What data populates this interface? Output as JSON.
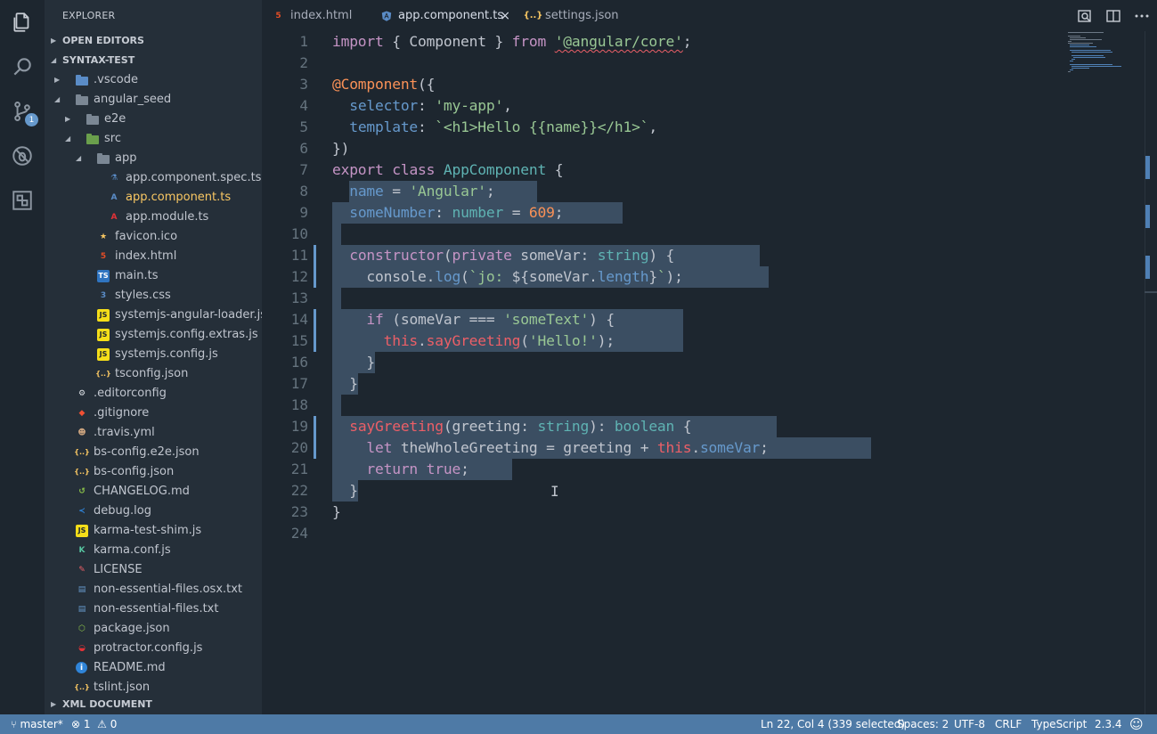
{
  "colors": {
    "accent": "#6699cc",
    "statusbar": "#4e7aa6",
    "sidebar": "#252f39",
    "editor": "#1d262f",
    "active_file": "#fac863"
  },
  "activity": {
    "icons": [
      "files-icon",
      "search-icon",
      "source-control-icon",
      "debug-icon",
      "extensions-icon"
    ],
    "scm_badge": "1"
  },
  "sidebar": {
    "title": "EXPLORER",
    "open_editors": "OPEN EDITORS",
    "project": "SYNTAX-TEST",
    "xml_document": "XML DOCUMENT",
    "tree": [
      {
        "label": ".vscode",
        "depth": 1,
        "twisty": "closed",
        "icon": "folder-blue"
      },
      {
        "label": "angular_seed",
        "depth": 1,
        "twisty": "open",
        "icon": "folder"
      },
      {
        "label": "e2e",
        "depth": 2,
        "twisty": "closed",
        "icon": "folder"
      },
      {
        "label": "src",
        "depth": 2,
        "twisty": "open",
        "icon": "folder-green"
      },
      {
        "label": "app",
        "depth": 3,
        "twisty": "open",
        "icon": "folder"
      },
      {
        "label": "app.component.spec.ts",
        "depth": 4,
        "icon": "flask"
      },
      {
        "label": "app.component.ts",
        "depth": 4,
        "icon": "angular-blue",
        "active": true
      },
      {
        "label": "app.module.ts",
        "depth": 4,
        "icon": "angular-red"
      },
      {
        "label": "favicon.ico",
        "depth": 3,
        "icon": "star"
      },
      {
        "label": "index.html",
        "depth": 3,
        "icon": "html5"
      },
      {
        "label": "main.ts",
        "depth": 3,
        "icon": "ts"
      },
      {
        "label": "styles.css",
        "depth": 3,
        "icon": "css3"
      },
      {
        "label": "systemjs-angular-loader.js",
        "depth": 3,
        "icon": "js"
      },
      {
        "label": "systemjs.config.extras.js",
        "depth": 3,
        "icon": "js"
      },
      {
        "label": "systemjs.config.js",
        "depth": 3,
        "icon": "js"
      },
      {
        "label": "tsconfig.json",
        "depth": 3,
        "icon": "json"
      },
      {
        "label": ".editorconfig",
        "depth": 1,
        "icon": "editorconfig"
      },
      {
        "label": ".gitignore",
        "depth": 1,
        "icon": "git"
      },
      {
        "label": ".travis.yml",
        "depth": 1,
        "icon": "travis"
      },
      {
        "label": "bs-config.e2e.json",
        "depth": 1,
        "icon": "json"
      },
      {
        "label": "bs-config.json",
        "depth": 1,
        "icon": "json"
      },
      {
        "label": "CHANGELOG.md",
        "depth": 1,
        "icon": "history"
      },
      {
        "label": "debug.log",
        "depth": 1,
        "icon": "vscode"
      },
      {
        "label": "karma-test-shim.js",
        "depth": 1,
        "icon": "js"
      },
      {
        "label": "karma.conf.js",
        "depth": 1,
        "icon": "karma"
      },
      {
        "label": "LICENSE",
        "depth": 1,
        "icon": "license"
      },
      {
        "label": "non-essential-files.osx.txt",
        "depth": 1,
        "icon": "text"
      },
      {
        "label": "non-essential-files.txt",
        "depth": 1,
        "icon": "text"
      },
      {
        "label": "package.json",
        "depth": 1,
        "icon": "npm"
      },
      {
        "label": "protractor.config.js",
        "depth": 1,
        "icon": "protractor"
      },
      {
        "label": "README.md",
        "depth": 1,
        "icon": "info"
      },
      {
        "label": "tslint.json",
        "depth": 1,
        "icon": "json"
      }
    ]
  },
  "tabs": [
    {
      "label": "index.html",
      "icon": "html5"
    },
    {
      "label": "app.component.ts",
      "icon": "angular-blue",
      "active": true,
      "close": "×"
    },
    {
      "label": "settings.json",
      "icon": "json"
    }
  ],
  "editor": {
    "lines": [
      [
        [
          "kw",
          "import"
        ],
        [
          "p",
          " { Component } "
        ],
        [
          "kw",
          "from"
        ],
        [
          "p",
          " "
        ],
        [
          "strsq",
          "'@angular/core'"
        ],
        [
          "p",
          ";"
        ]
      ],
      [],
      [
        [
          "dec",
          "@Component"
        ],
        [
          "p",
          "({"
        ]
      ],
      [
        [
          "p",
          "  "
        ],
        [
          "prop",
          "selector"
        ],
        [
          "p",
          ": "
        ],
        [
          "str",
          "'my-app'"
        ],
        [
          "p",
          ","
        ]
      ],
      [
        [
          "p",
          "  "
        ],
        [
          "prop",
          "template"
        ],
        [
          "p",
          ": "
        ],
        [
          "str",
          "`<h1>Hello {{name}}</h1>`"
        ],
        [
          "p",
          ","
        ]
      ],
      [
        [
          "p",
          "})"
        ]
      ],
      [
        [
          "kw",
          "export"
        ],
        [
          "p",
          " "
        ],
        [
          "kw",
          "class"
        ],
        [
          "p",
          " "
        ],
        [
          "typ",
          "AppComponent"
        ],
        [
          "p",
          " {"
        ]
      ],
      [
        [
          "p",
          "  "
        ],
        [
          "prop",
          "name"
        ],
        [
          "p",
          " = "
        ],
        [
          "str",
          "'Angular'"
        ],
        [
          "p",
          ";"
        ]
      ],
      [
        [
          "p",
          "  "
        ],
        [
          "prop",
          "someNumber"
        ],
        [
          "p",
          ": "
        ],
        [
          "typ",
          "number"
        ],
        [
          "p",
          " = "
        ],
        [
          "num",
          "609"
        ],
        [
          "p",
          ";"
        ]
      ],
      [],
      [
        [
          "p",
          "  "
        ],
        [
          "kw",
          "constructor"
        ],
        [
          "p",
          "("
        ],
        [
          "kw",
          "private"
        ],
        [
          "p",
          " someVar: "
        ],
        [
          "typ",
          "string"
        ],
        [
          "p",
          ") {"
        ]
      ],
      [
        [
          "p",
          "    console."
        ],
        [
          "prop",
          "log"
        ],
        [
          "p",
          "("
        ],
        [
          "str",
          "`jo: "
        ],
        [
          "p",
          "${someVar."
        ],
        [
          "prop",
          "length"
        ],
        [
          "p",
          "}"
        ],
        [
          "str",
          "`"
        ],
        [
          "p",
          ");"
        ]
      ],
      [],
      [
        [
          "p",
          "    "
        ],
        [
          "kw",
          "if"
        ],
        [
          "p",
          " (someVar === "
        ],
        [
          "str",
          "'someText'"
        ],
        [
          "p",
          ") {"
        ]
      ],
      [
        [
          "p",
          "      "
        ],
        [
          "this",
          "this"
        ],
        [
          "p",
          "."
        ],
        [
          "fn",
          "sayGreeting"
        ],
        [
          "p",
          "("
        ],
        [
          "str",
          "'Hello!'"
        ],
        [
          "p",
          ");"
        ]
      ],
      [
        [
          "p",
          "    }"
        ]
      ],
      [
        [
          "p",
          "  }"
        ]
      ],
      [],
      [
        [
          "p",
          "  "
        ],
        [
          "fn",
          "sayGreeting"
        ],
        [
          "p",
          "(greeting: "
        ],
        [
          "typ",
          "string"
        ],
        [
          "p",
          "): "
        ],
        [
          "typ",
          "boolean"
        ],
        [
          "p",
          " {"
        ]
      ],
      [
        [
          "p",
          "    "
        ],
        [
          "kw",
          "let"
        ],
        [
          "p",
          " theWholeGreeting = greeting + "
        ],
        [
          "this",
          "this"
        ],
        [
          "p",
          "."
        ],
        [
          "prop",
          "someVar"
        ],
        [
          "p",
          ";"
        ]
      ],
      [
        [
          "p",
          "    "
        ],
        [
          "kw",
          "return"
        ],
        [
          "p",
          " "
        ],
        [
          "kw",
          "true"
        ],
        [
          "p",
          ";"
        ]
      ],
      [
        [
          "p",
          "  }"
        ]
      ],
      [
        [
          "p",
          "}"
        ]
      ],
      []
    ],
    "selection_ends": [
      0,
      0,
      0,
      0,
      0,
      0,
      0,
      24,
      34,
      1,
      50,
      51,
      1,
      41,
      41,
      5,
      3,
      1,
      52,
      63,
      21,
      3,
      0,
      0
    ]
  },
  "status": {
    "branch": "master*",
    "errors": "1",
    "warnings": "0",
    "position": "Ln 22, Col 4 (339 selected)",
    "spaces": "Spaces: 2",
    "encoding": "UTF-8",
    "eol": "CRLF",
    "language": "TypeScript",
    "version": "2.3.4"
  }
}
